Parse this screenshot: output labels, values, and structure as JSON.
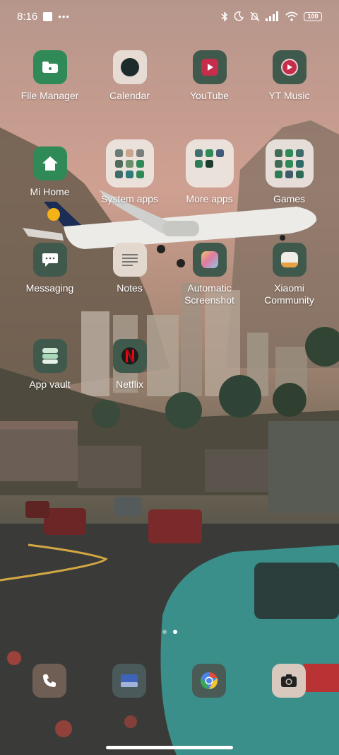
{
  "status_bar": {
    "time": "8:16",
    "battery": "100",
    "icons": [
      "bluetooth-icon",
      "moon-icon",
      "bell-off-icon",
      "signal-icon",
      "wifi-icon"
    ]
  },
  "apps": [
    {
      "label": "File Manager",
      "icon": "folder-icon",
      "color": "#2e8b57"
    },
    {
      "label": "Calendar",
      "icon": "calendar-icon",
      "color": "#1e2b2b"
    },
    {
      "label": "YouTube",
      "icon": "youtube-play-icon",
      "color": "#c62d4a"
    },
    {
      "label": "YT Music",
      "icon": "music-play-icon",
      "color": "#c62d4a"
    },
    {
      "label": "Mi Home",
      "icon": "home-icon",
      "color": "#2e8b57"
    },
    {
      "label": "System apps",
      "icon": "folder-grid-icon"
    },
    {
      "label": "More apps",
      "icon": "folder-grid-icon"
    },
    {
      "label": "Games",
      "icon": "folder-grid-icon"
    },
    {
      "label": "Messaging",
      "icon": "chat-bubble-icon"
    },
    {
      "label": "Notes",
      "icon": "notes-lines-icon"
    },
    {
      "label": "Automatic Screenshot",
      "icon": "gradient-square-icon"
    },
    {
      "label": "Xiaomi Community",
      "icon": "community-icon"
    },
    {
      "label": "App vault",
      "icon": "stack-icon"
    },
    {
      "label": "Netflix",
      "icon": "netflix-n-icon",
      "color": "#e50914"
    }
  ],
  "dock": [
    {
      "name": "phone",
      "icon": "phone-icon"
    },
    {
      "name": "files",
      "icon": "blue-card-icon"
    },
    {
      "name": "chrome",
      "icon": "chrome-icon"
    },
    {
      "name": "camera",
      "icon": "camera-icon"
    }
  ],
  "page_indicator": {
    "pages": 2,
    "current": 2
  },
  "wallpaper": {
    "sky": "#c79a89",
    "road": "#3b3d3a",
    "car": "#3a8f8a"
  }
}
